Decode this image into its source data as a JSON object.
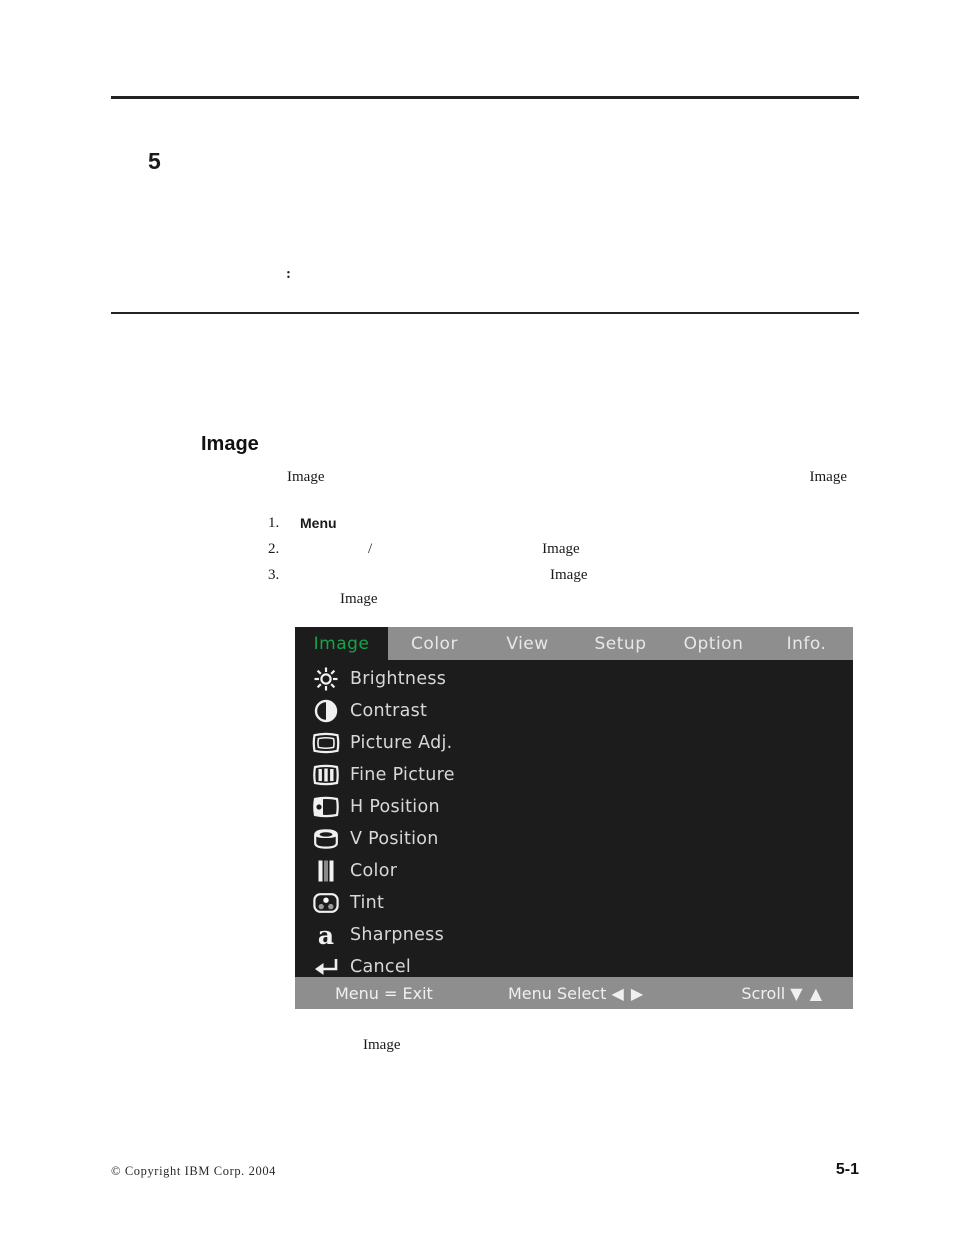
{
  "chapter": {
    "number": "5",
    "title": "",
    "intro": "",
    "note_colon": ":"
  },
  "section": {
    "title": "Image",
    "para_left_word": "Image",
    "para_right_word": "Image"
  },
  "steps": [
    {
      "num": "1.",
      "text": "Menu",
      "bold": true
    },
    {
      "num": "2.",
      "slash": "/",
      "image_word": "Image"
    },
    {
      "num": "3.",
      "image_word": "Image"
    }
  ],
  "steps_trailer": "Image",
  "osd": {
    "tabs": [
      {
        "label": "Image",
        "active": true
      },
      {
        "label": "Color",
        "active": false
      },
      {
        "label": "View",
        "active": false
      },
      {
        "label": "Setup",
        "active": false
      },
      {
        "label": "Option",
        "active": false
      },
      {
        "label": "Info.",
        "active": false
      }
    ],
    "items": [
      {
        "label": "Brightness",
        "icon": "brightness-icon"
      },
      {
        "label": "Contrast",
        "icon": "contrast-icon"
      },
      {
        "label": "Picture Adj.",
        "icon": "picture-adjust-icon"
      },
      {
        "label": "Fine Picture",
        "icon": "fine-picture-icon"
      },
      {
        "label": "H Position",
        "icon": "h-position-icon"
      },
      {
        "label": "V Position",
        "icon": "v-position-icon"
      },
      {
        "label": "Color",
        "icon": "color-bars-icon"
      },
      {
        "label": "Tint",
        "icon": "tint-icon"
      },
      {
        "label": "Sharpness",
        "icon": "sharpness-icon"
      },
      {
        "label": "Cancel",
        "icon": "return-arrow-icon"
      }
    ],
    "footer": {
      "left": "Menu = Exit",
      "center": "Menu Select",
      "center_arrows": "◀ ▶",
      "right": "Scroll",
      "right_arrows": "▼ ▲"
    },
    "colors": {
      "panel_bg": "#1c1c1c",
      "bar_bg": "#8e8e8e",
      "active_tab_text": "#16a34a",
      "label_text": "#d8d8d8"
    }
  },
  "figure_caption": "Image",
  "page_footer": {
    "copyright": "©  Copyright  IBM  Corp.  2004",
    "page_number": "5-1"
  }
}
